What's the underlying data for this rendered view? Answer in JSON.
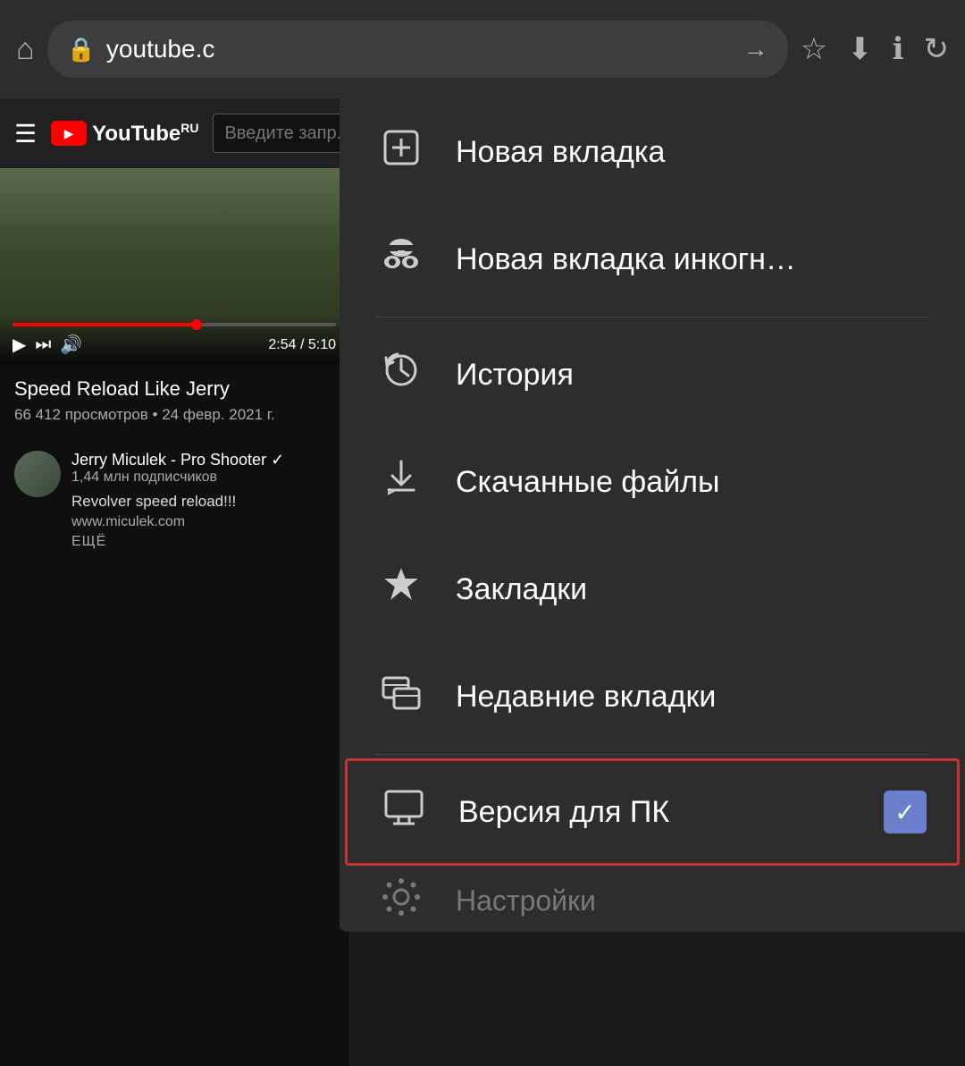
{
  "browser": {
    "url": "youtube.c",
    "home_icon": "⌂",
    "lock_icon": "🔒",
    "arrow_icon": "→",
    "star_icon": "☆",
    "download_icon": "⬇",
    "info_icon": "ℹ",
    "refresh_icon": "↻"
  },
  "youtube": {
    "logo_text": "YouTube",
    "logo_sup": "RU",
    "search_placeholder": "Введите запр...",
    "hamburger": "☰"
  },
  "video": {
    "title": "Speed Reload Like Jerry",
    "meta": "66 412 просмотров • 24 февр. 2021 г.",
    "time_current": "2:54",
    "time_total": "5:10",
    "channel_name": "Jerry Miculek - Pro Shooter ✓",
    "channel_subs": "1,44 млн подписчиков",
    "channel_desc": "Revolver speed reload!!!",
    "channel_link": "www.miculek.com",
    "more": "ЕЩЁ"
  },
  "menu": {
    "items": [
      {
        "id": "new-tab",
        "icon": "⊕",
        "label": "Новая вкладка"
      },
      {
        "id": "incognito",
        "icon": "🕵",
        "label": "Новая вкладка инкогн…"
      },
      {
        "id": "history",
        "icon": "🕐",
        "label": "История"
      },
      {
        "id": "downloads",
        "icon": "⬇",
        "label": "Скачанные файлы"
      },
      {
        "id": "bookmarks",
        "icon": "★",
        "label": "Закладки"
      },
      {
        "id": "recent-tabs",
        "icon": "⬜",
        "label": "Недавние вкладки"
      },
      {
        "id": "desktop-version",
        "icon": "🖥",
        "label": "Версия для ПК",
        "checked": true,
        "highlighted": true
      },
      {
        "id": "settings",
        "icon": "⚙",
        "label": "Настройки",
        "partial": true
      }
    ]
  }
}
